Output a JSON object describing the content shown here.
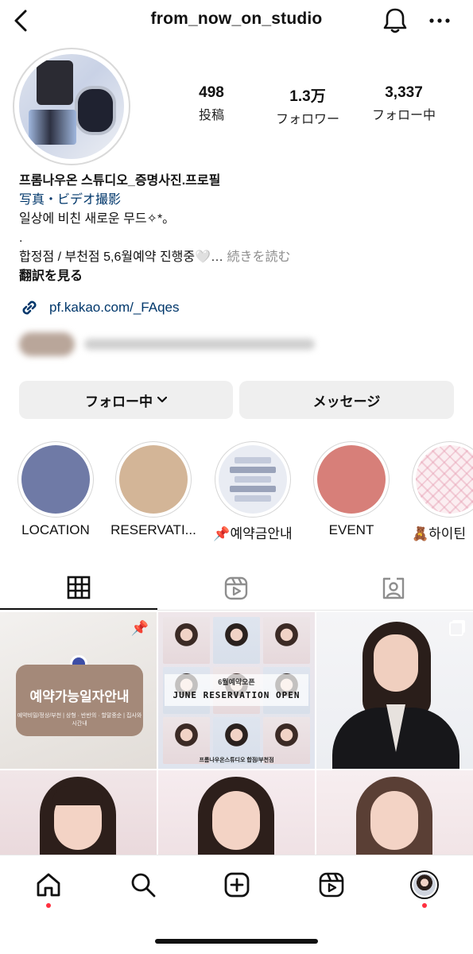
{
  "header": {
    "title": "from_now_on_studio"
  },
  "stats": [
    {
      "value": "498",
      "label": "投稿"
    },
    {
      "value": "1.3万",
      "label": "フォロワー"
    },
    {
      "value": "3,337",
      "label": "フォロー中"
    }
  ],
  "bio": {
    "name": "프롬나우온 스튜디오_증명사진.프로필",
    "category": "写真・ビデオ撮影",
    "line1": "일상에 비친 새로운 무드✧*。",
    "line2": ".",
    "line3": "합정점 / 부천점 5,6월예약 진행중🤍…",
    "more": "続きを読む",
    "translate": "翻訳を見る"
  },
  "link": {
    "text": "pf.kakao.com/_FAqes"
  },
  "buttons": {
    "follow": "フォロー中",
    "message": "メッセージ"
  },
  "highlights": [
    {
      "label": "LOCATION",
      "color": "#6f7aa6"
    },
    {
      "label": "RESERVATI...",
      "color": "#d3b597"
    },
    {
      "label": "📌예약금안내"
    },
    {
      "label": "EVENT",
      "color": "#d77f79"
    },
    {
      "label": "🧸하이틴"
    }
  ],
  "posts": {
    "p1": {
      "title": "예약가능일자안내",
      "sub": "예약비밀/정상/부천 | 상형 · 반반의 · 할말중순 | 집사와 시간내"
    },
    "p2": {
      "small": "6월예약오픈",
      "big": "JUNE RESERVATION OPEN",
      "footer": "프롬나우온스튜디오 합점/부천점"
    }
  },
  "colors": {
    "link": "#00376b",
    "button_bg": "#efefef",
    "notification_dot": "#ff3040"
  }
}
